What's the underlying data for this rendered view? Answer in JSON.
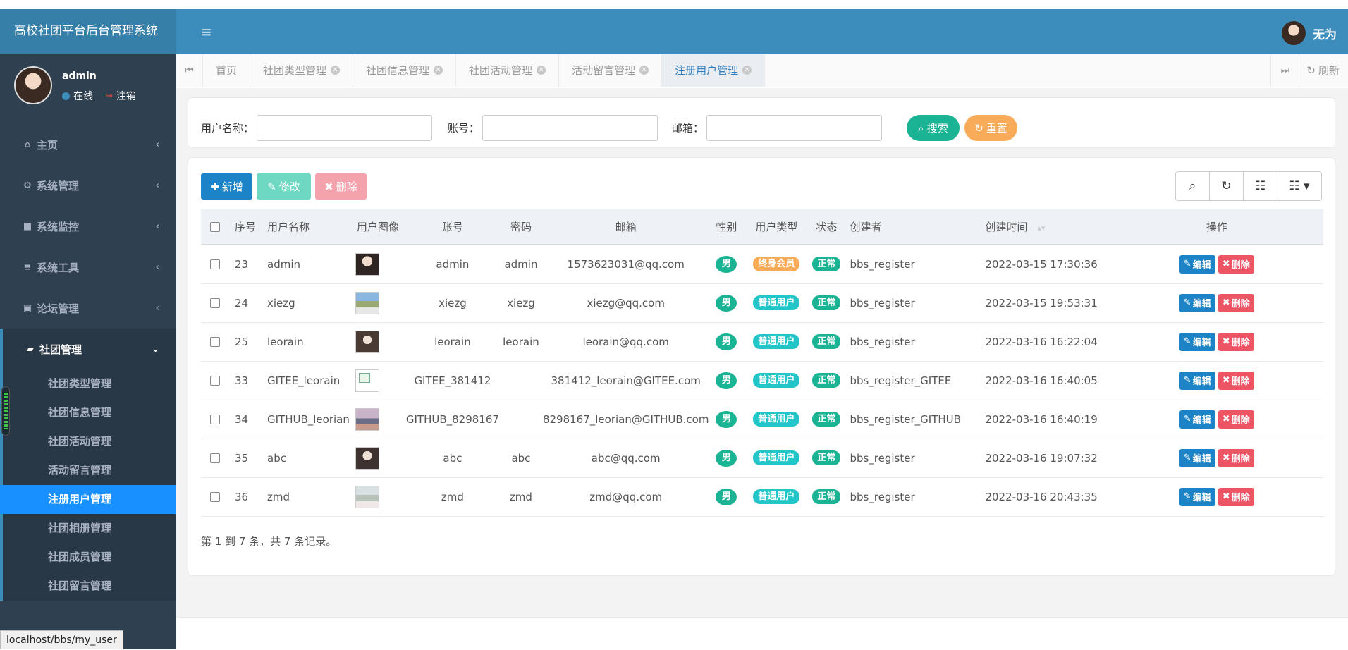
{
  "app": {
    "brand": "高校社团平台后台管理系统"
  },
  "sidebar": {
    "user_name": "admin",
    "online_text": "在线",
    "logout_text": "注销",
    "menu": [
      {
        "label": "主页",
        "icon": "home-icon"
      },
      {
        "label": "系统管理",
        "icon": "gear-icon"
      },
      {
        "label": "系统监控",
        "icon": "video-icon"
      },
      {
        "label": "系统工具",
        "icon": "bars-icon"
      },
      {
        "label": "论坛管理",
        "icon": "id-card-icon"
      }
    ],
    "active_group": {
      "label": "社团管理",
      "icon": "car-icon"
    },
    "sub_items": [
      "社团类型管理",
      "社团信息管理",
      "社团活动管理",
      "活动留言管理",
      "注册用户管理",
      "社团相册管理",
      "社团成员管理",
      "社团留言管理"
    ],
    "status_url": "localhost/bbs/my_user"
  },
  "header": {
    "user_name": "无为"
  },
  "tabs": {
    "items": [
      "首页",
      "社团类型管理",
      "社团信息管理",
      "社团活动管理",
      "活动留言管理",
      "注册用户管理"
    ],
    "refresh_label": "刷新"
  },
  "search": {
    "username_label": "用户名称：",
    "account_label": "账号：",
    "email_label": "邮箱：",
    "search_label": "搜索",
    "reset_label": "重置"
  },
  "toolbar": {
    "add_label": "新增",
    "edit_label": "修改",
    "delete_label": "删除"
  },
  "table": {
    "headers": [
      "序号",
      "用户名称",
      "用户图像",
      "账号",
      "密码",
      "邮箱",
      "性别",
      "用户类型",
      "状态",
      "创建者",
      "创建时间",
      "操作"
    ],
    "op_edit": "编辑",
    "op_delete": "删除",
    "rows": [
      {
        "id": "23",
        "name": "admin",
        "account": "admin",
        "password": "admin",
        "email": "1573623031@qq.com",
        "sex": "男",
        "type": "终身会员",
        "status": "正常",
        "creator": "bbs_register",
        "created": "2022-03-15 17:30:36"
      },
      {
        "id": "24",
        "name": "xiezg",
        "account": "xiezg",
        "password": "xiezg",
        "email": "xiezg@qq.com",
        "sex": "男",
        "type": "普通用户",
        "status": "正常",
        "creator": "bbs_register",
        "created": "2022-03-15 19:53:31"
      },
      {
        "id": "25",
        "name": "leorain",
        "account": "leorain",
        "password": "leorain",
        "email": "leorain@qq.com",
        "sex": "男",
        "type": "普通用户",
        "status": "正常",
        "creator": "bbs_register",
        "created": "2022-03-16 16:22:04"
      },
      {
        "id": "33",
        "name": "GITEE_leorain",
        "account": "GITEE_381412",
        "password": "",
        "email": "381412_leorain@GITEE.com",
        "sex": "男",
        "type": "普通用户",
        "status": "正常",
        "creator": "bbs_register_GITEE",
        "created": "2022-03-16 16:40:05"
      },
      {
        "id": "34",
        "name": "GITHUB_leorian",
        "account": "GITHUB_8298167",
        "password": "",
        "email": "8298167_leorian@GITHUB.com",
        "sex": "男",
        "type": "普通用户",
        "status": "正常",
        "creator": "bbs_register_GITHUB",
        "created": "2022-03-16 16:40:19"
      },
      {
        "id": "35",
        "name": "abc",
        "account": "abc",
        "password": "abc",
        "email": "abc@qq.com",
        "sex": "男",
        "type": "普通用户",
        "status": "正常",
        "creator": "bbs_register",
        "created": "2022-03-16 19:07:32"
      },
      {
        "id": "36",
        "name": "zmd",
        "account": "zmd",
        "password": "zmd",
        "email": "zmd@qq.com",
        "sex": "男",
        "type": "普通用户",
        "status": "正常",
        "creator": "bbs_register",
        "created": "2022-03-16 20:43:35"
      }
    ],
    "footer": "第 1 到 7 条，共 7 条记录。"
  },
  "colors": {
    "header": "#3c8dbc",
    "sidebar": "#2f4050",
    "active": "#1890ff",
    "primary": "#1ab394"
  }
}
